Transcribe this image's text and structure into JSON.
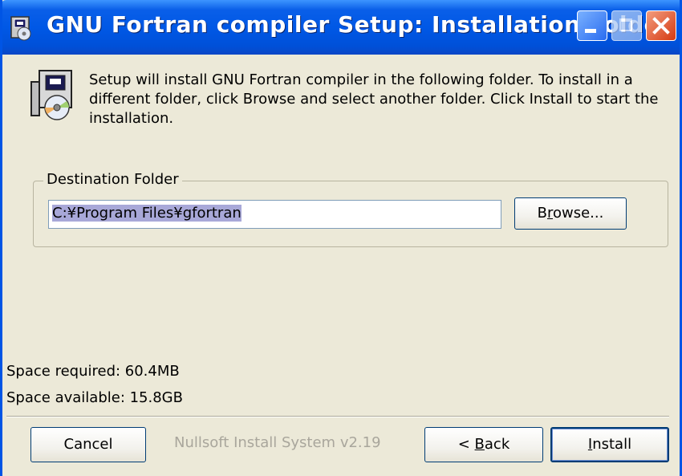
{
  "window": {
    "title": "GNU Fortran compiler Setup: Installation Folder",
    "icons": {
      "app": "setup-installer-icon",
      "minimize": "minimize-icon",
      "maximize": "maximize-icon",
      "close": "close-icon"
    }
  },
  "header": {
    "description": "Setup will install GNU Fortran compiler in the following folder. To install in a different folder, click Browse and select another folder. Click Install to start the installation.",
    "icon": "setup-cd-icon"
  },
  "destination": {
    "group_label": "Destination Folder",
    "path_value": "C:¥Program Files¥gfortran",
    "browse_label_pre": "B",
    "browse_label_accel": "r",
    "browse_label_post": "owse..."
  },
  "space": {
    "required": "Space required: 60.4MB",
    "available": "Space available: 15.8GB"
  },
  "footer": {
    "branding": "Nullsoft Install System v2.19",
    "cancel_label": "Cancel",
    "back_label_pre": "< ",
    "back_label_accel": "B",
    "back_label_post": "ack",
    "install_label_accel": "I",
    "install_label_post": "nstall"
  },
  "colors": {
    "titlebar": "#0058e6",
    "face": "#ece9d8",
    "close": "#d53a12",
    "selection": "#a8a8d8"
  }
}
